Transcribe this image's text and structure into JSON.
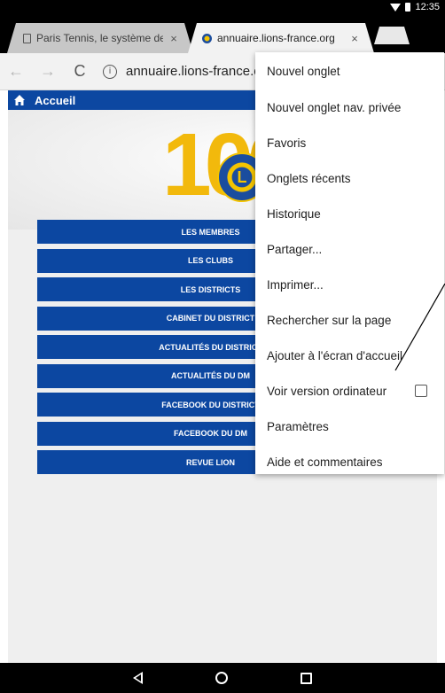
{
  "status_bar": {
    "time": "12:35"
  },
  "tabs": [
    {
      "label": "Paris Tennis, le système de r",
      "close": "×",
      "icon": "document-icon"
    },
    {
      "label": "annuaire.lions-france.org",
      "close": "×",
      "icon": "lions-favicon"
    }
  ],
  "toolbar": {
    "back": "←",
    "forward": "→",
    "reload": "C",
    "info": "i",
    "url": "annuaire.lions-france.org"
  },
  "page": {
    "header_title": "Accueil",
    "hero_number": "100",
    "logo_letter": "L",
    "menu": [
      "LES MEMBRES",
      "LES CLUBS",
      "LES DISTRICTS",
      "CABINET DU DISTRICT",
      "ACTUALITÉS DU DISTRICT",
      "ACTUALITÉS DU DM",
      "FACEBOOK DU DISTRICT",
      "FACEBOOK DU DM",
      "REVUE LION"
    ]
  },
  "overflow_menu": [
    "Nouvel onglet",
    "Nouvel onglet nav. privée",
    "Favoris",
    "Onglets récents",
    "Historique",
    "Partager...",
    "Imprimer...",
    "Rechercher sur la page",
    "Ajouter à l'écran d'accueil",
    "Voir version ordinateur",
    "Paramètres",
    "Aide et commentaires"
  ],
  "colors": {
    "brand_blue": "#0c47a1",
    "brand_gold": "#f2b90c"
  }
}
